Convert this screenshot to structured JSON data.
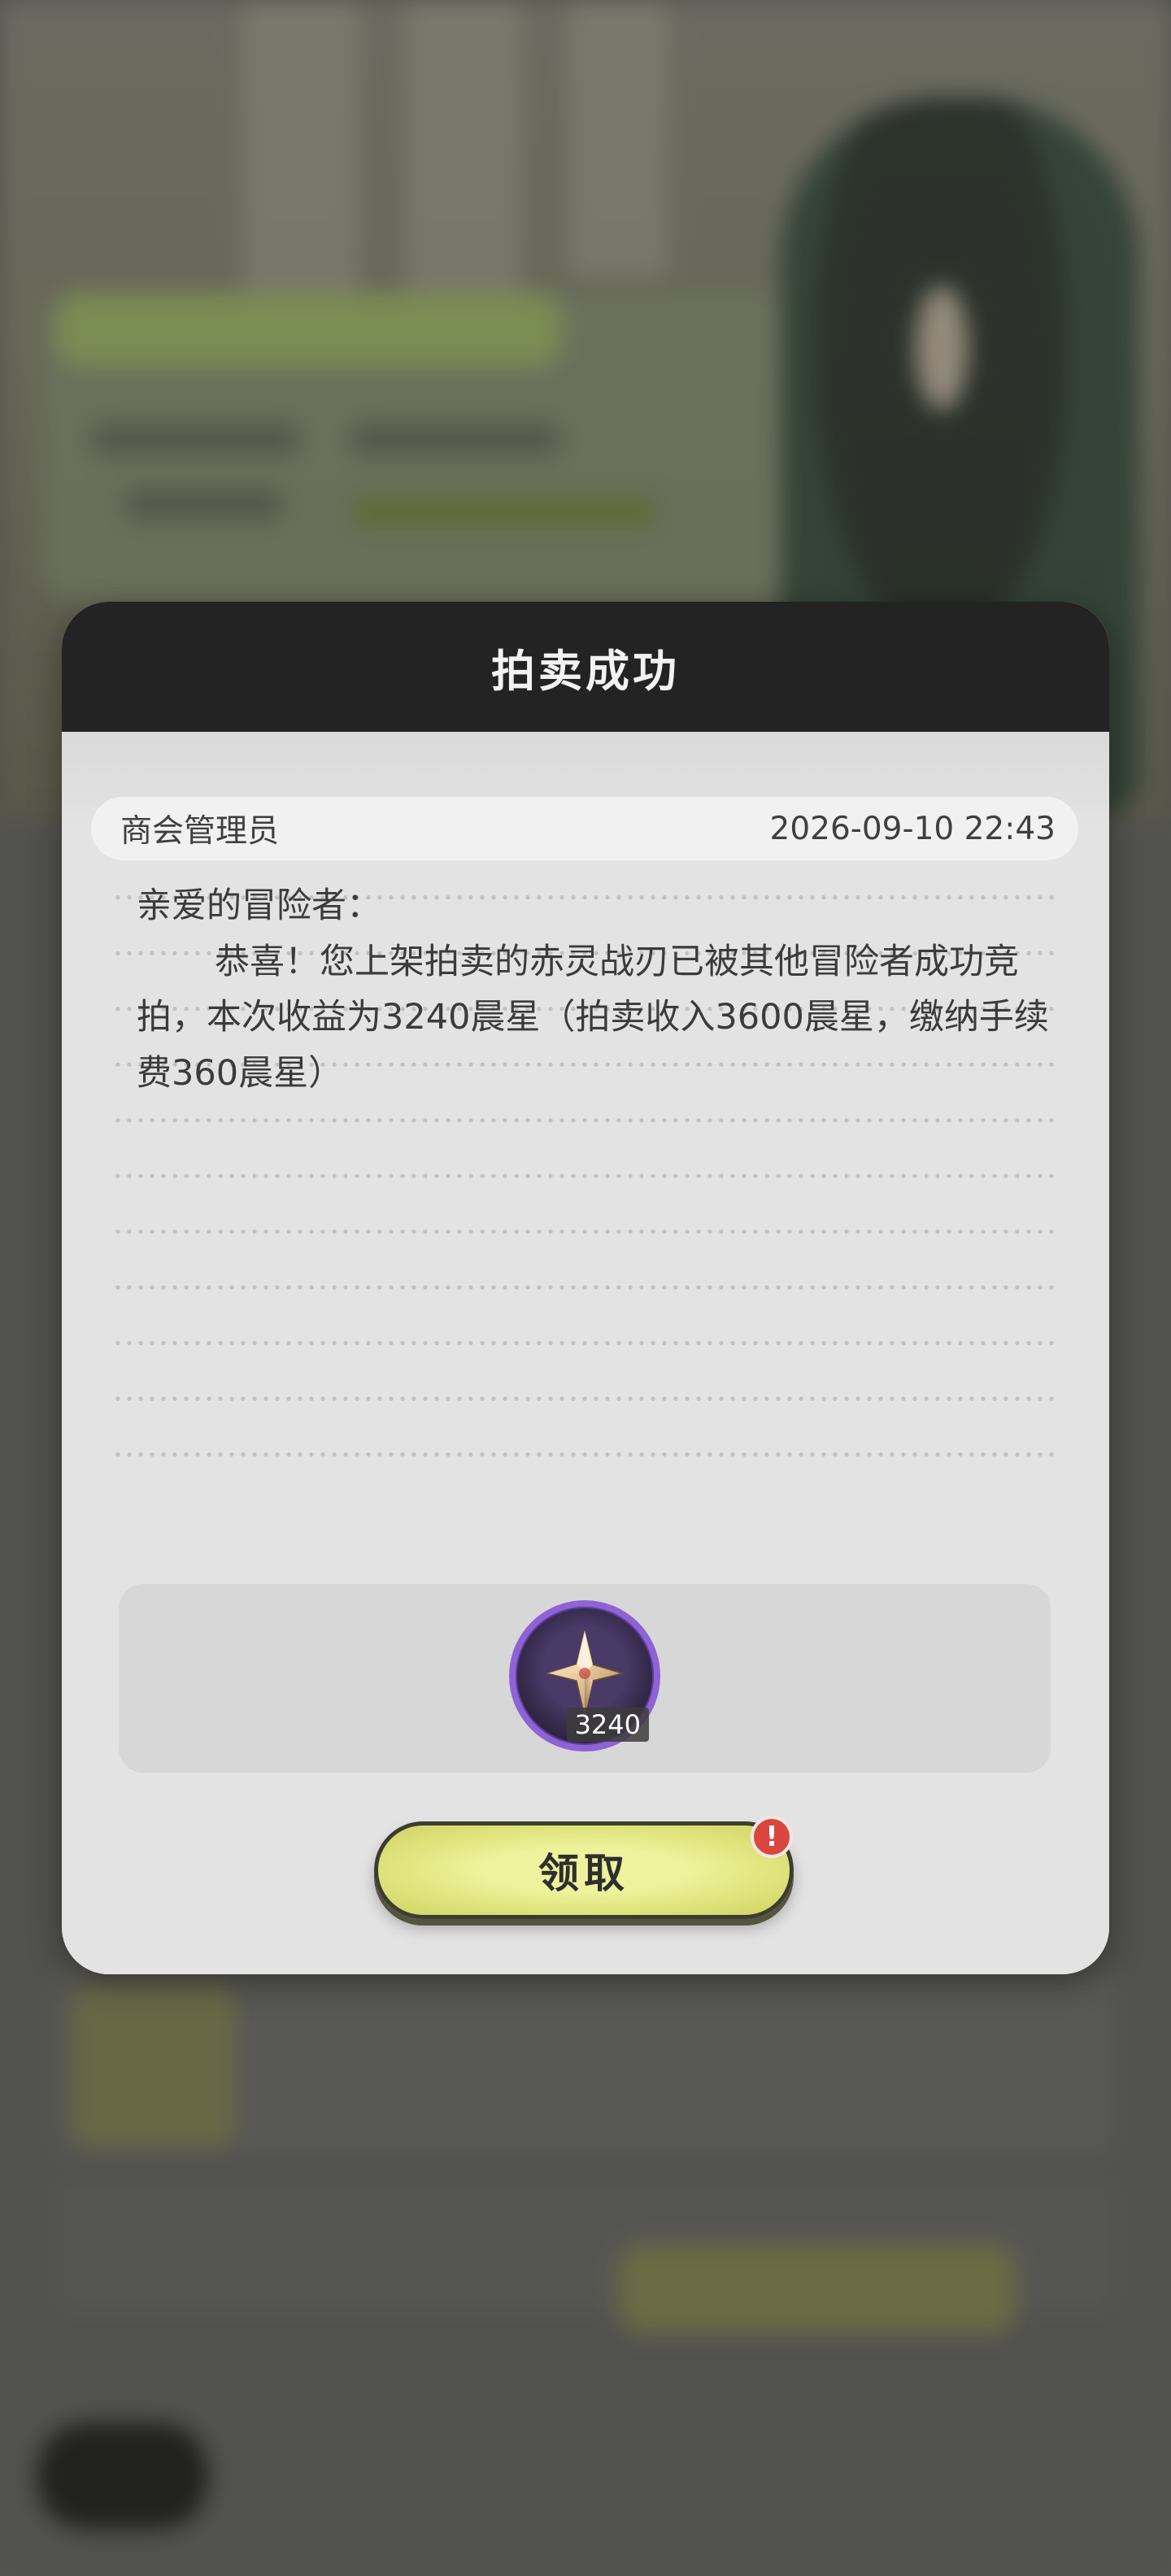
{
  "dialog": {
    "title": "拍卖成功",
    "sender": "商会管理员",
    "timestamp": "2026-09-10 22:43",
    "greeting": "亲爱的冒险者：",
    "body": "恭喜！您上架拍卖的赤灵战刃已被其他冒险者成功竞拍，本次收益为3240晨星（拍卖收入3600晨星，缴纳手续费360晨星）",
    "reward": {
      "icon": "star-crystal-icon",
      "count": "3240"
    },
    "claim_label": "领取",
    "claim_alert": "!"
  },
  "colors": {
    "header": "#232323",
    "panel": "#e3e3e3",
    "button": "#dfe47d",
    "reward_ring": "#8d63d6",
    "alert": "#d9463f"
  }
}
